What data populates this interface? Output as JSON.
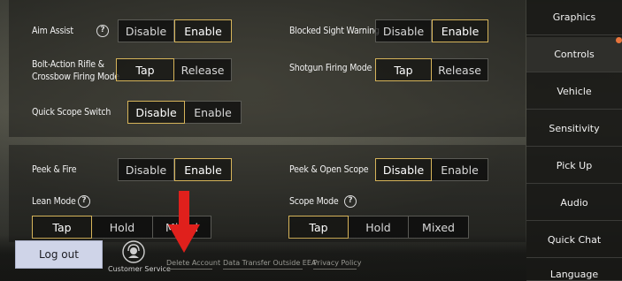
{
  "settings": {
    "aim_assist": {
      "label": "Aim Assist",
      "options": [
        "Disable",
        "Enable"
      ],
      "selected": "Enable"
    },
    "blocked_sight": {
      "label": "Blocked Sight Warning",
      "options": [
        "Disable",
        "Enable"
      ],
      "selected": "Enable"
    },
    "bolt_action": {
      "label_line1": "Bolt-Action Rifle &",
      "label_line2": "Crossbow Firing Mode",
      "options": [
        "Tap",
        "Release"
      ],
      "selected": "Tap"
    },
    "shotgun": {
      "label": "Shotgun Firing Mode",
      "options": [
        "Tap",
        "Release"
      ],
      "selected": "Tap"
    },
    "quick_scope": {
      "label": "Quick Scope Switch",
      "options": [
        "Disable",
        "Enable"
      ],
      "selected": "Disable"
    },
    "peek_fire": {
      "label": "Peek & Fire",
      "options": [
        "Disable",
        "Enable"
      ],
      "selected": "Enable"
    },
    "peek_open_scope": {
      "label": "Peek & Open Scope",
      "options": [
        "Disable",
        "Enable"
      ],
      "selected": "Disable"
    },
    "lean_mode": {
      "label": "Lean Mode",
      "options": [
        "Tap",
        "Hold",
        "Mixed"
      ],
      "selected": "Tap"
    },
    "scope_mode": {
      "label": "Scope Mode",
      "options": [
        "Tap",
        "Hold",
        "Mixed"
      ],
      "selected": "Tap"
    }
  },
  "sidebar": {
    "items": [
      {
        "label": "Graphics"
      },
      {
        "label": "Controls"
      },
      {
        "label": "Vehicle"
      },
      {
        "label": "Sensitivity"
      },
      {
        "label": "Pick Up"
      },
      {
        "label": "Audio"
      },
      {
        "label": "Quick Chat"
      },
      {
        "label": "Language"
      }
    ],
    "active_index": 1
  },
  "footer": {
    "logout": "Log out",
    "customer_service": "Customer Service",
    "delete_account": "Delete Account",
    "data_transfer": "Data Transfer Outside EEA",
    "privacy_policy": "Privacy Policy"
  },
  "help_glyph": "?",
  "colors": {
    "selected_border": "#d6b45a",
    "notification_dot": "#e8743c",
    "arrow": "#e0201c"
  },
  "icons": {
    "help": "question-circle-icon",
    "customer_service": "headset-icon",
    "annotation": "red-down-arrow"
  }
}
